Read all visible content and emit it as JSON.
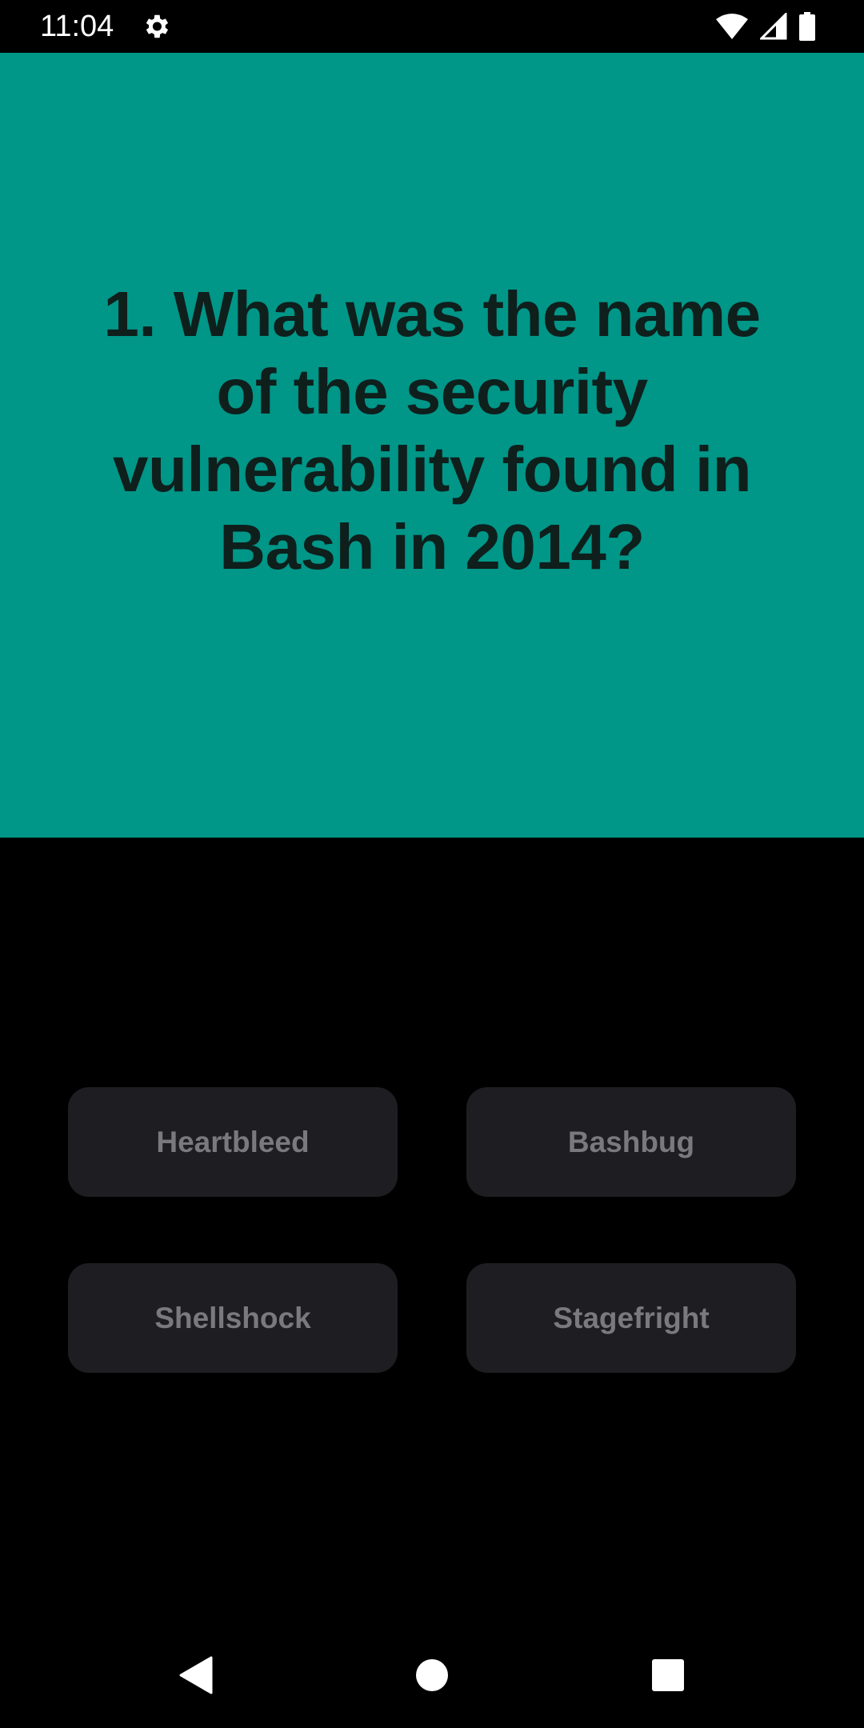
{
  "status_bar": {
    "time": "11:04",
    "settings_icon": "gear-icon",
    "wifi_icon": "wifi-icon",
    "signal_icon": "cell-signal-icon",
    "battery_icon": "battery-icon"
  },
  "colors": {
    "accent": "#009688",
    "question_text": "#0e1f1c",
    "answer_bg": "#1e1e22",
    "answer_text": "#7a7a7e",
    "background": "#000000"
  },
  "quiz": {
    "question": "1. What was the name of the security vulnerability found in Bash in 2014?",
    "answers": [
      {
        "label": "Heartbleed"
      },
      {
        "label": "Bashbug"
      },
      {
        "label": "Shellshock"
      },
      {
        "label": "Stagefright"
      }
    ]
  },
  "nav_bar": {
    "back_icon": "back-triangle-icon",
    "home_icon": "home-circle-icon",
    "recents_icon": "recents-square-icon"
  }
}
